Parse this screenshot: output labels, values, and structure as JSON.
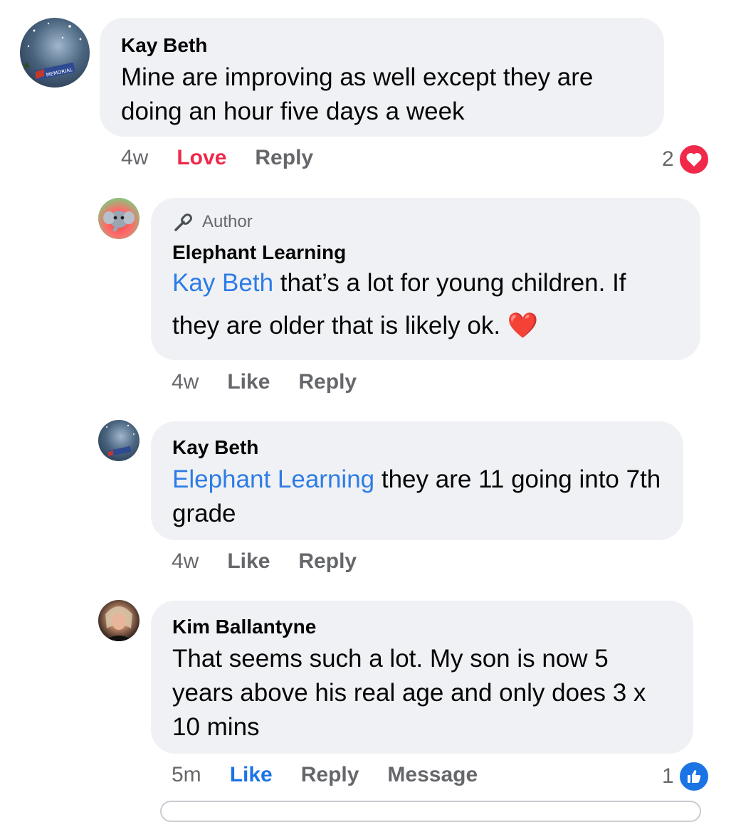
{
  "comments": [
    {
      "author": "Kay Beth",
      "text": "Mine are improving as well except they are doing an hour five days a week",
      "time": "4w",
      "action1": "Love",
      "action2": "Reply",
      "reaction_count": "2",
      "reaction_icon": "heart-icon",
      "avatar_badge": "MEMORIAL"
    },
    {
      "author_tag": "Author",
      "author": "Elephant Learning",
      "mention": "Kay Beth",
      "text": " that’s a lot for young children. If they are older that is likely ok. ",
      "emoji": "❤️",
      "time": "4w",
      "action1": "Like",
      "action2": "Reply"
    },
    {
      "author": "Kay Beth",
      "mention": "Elephant Learning",
      "text": " they are 11 going into 7th grade",
      "time": "4w",
      "action1": "Like",
      "action2": "Reply",
      "avatar_badge": "MEMORIAL"
    },
    {
      "author": "Kim Ballantyne",
      "text": "That seems such a lot. My son is now 5 years above his real age and only does 3 x 10 mins",
      "time": "5m",
      "action1": "Like",
      "action2": "Reply",
      "action3": "Message",
      "reaction_count": "1",
      "reaction_icon": "thumbs-up-icon"
    }
  ],
  "colors": {
    "bubble": "#f0f1f4",
    "mention": "#2d7ce6",
    "love": "#f0284a",
    "like_active": "#1b74e4",
    "muted": "#65676b"
  }
}
